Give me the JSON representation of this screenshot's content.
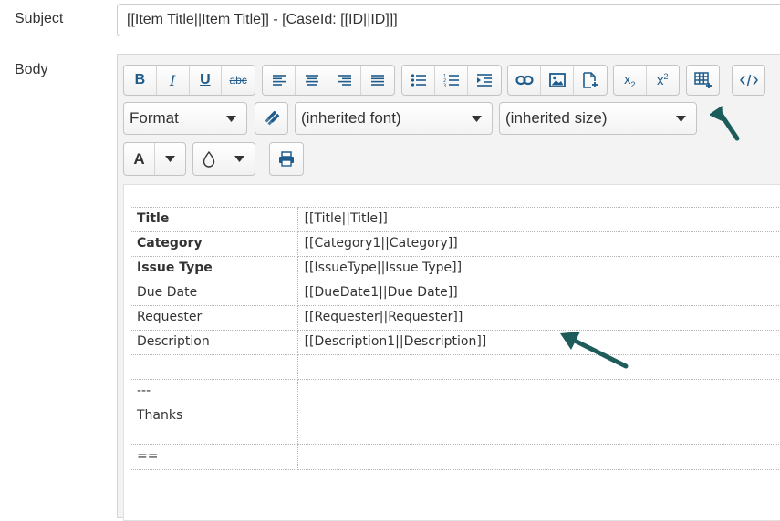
{
  "form": {
    "subject_label": "Subject",
    "subject_value": "[[Item Title||Item Title]] - [CaseId: [[ID||ID]]]",
    "body_label": "Body"
  },
  "toolbar": {
    "format_label": "Format",
    "font_value": "(inherited font)",
    "size_value": "(inherited size)",
    "text_color_label": "A",
    "buttons": {
      "bold": "B",
      "italic": "I",
      "underline": "U",
      "strikethrough": "abc"
    }
  },
  "body_table": {
    "rows": [
      {
        "label": "Title",
        "value": "[[Title||Title]]",
        "bold": true
      },
      {
        "label": "Category",
        "value": "[[Category1||Category]]",
        "bold": true
      },
      {
        "label": "Issue Type",
        "value": "[[IssueType||Issue Type]]",
        "bold": true
      },
      {
        "label": "Due Date",
        "value": "[[DueDate1||Due Date]]",
        "bold": false
      },
      {
        "label": "Requester",
        "value": "[[Requester||Requester]]",
        "bold": false
      },
      {
        "label": "Description",
        "value": "[[Description1||Description]]",
        "bold": false
      },
      {
        "label": "",
        "value": "",
        "bold": false
      },
      {
        "label": "---",
        "value": "",
        "bold": false
      },
      {
        "label": "Thanks",
        "value": "",
        "bold": false
      },
      {
        "label": "==",
        "value": "",
        "bold": false
      }
    ]
  },
  "colors": {
    "icon_blue": "#1f5c8c",
    "arrow_teal": "#1e5b5b"
  }
}
